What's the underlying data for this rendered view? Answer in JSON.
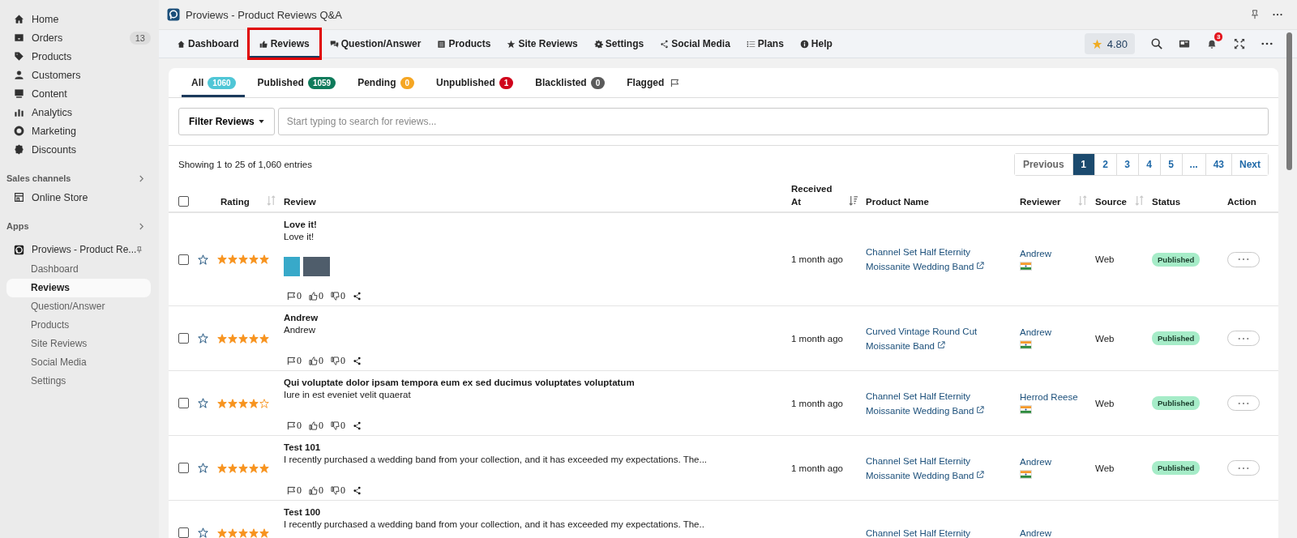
{
  "sidebar": {
    "items": [
      {
        "label": "Home",
        "selected": false
      },
      {
        "label": "Orders",
        "badge": "13",
        "selected": false
      },
      {
        "label": "Products",
        "selected": false
      },
      {
        "label": "Customers",
        "selected": false
      },
      {
        "label": "Content",
        "selected": false
      },
      {
        "label": "Analytics",
        "selected": false
      },
      {
        "label": "Marketing",
        "selected": false
      },
      {
        "label": "Discounts",
        "selected": false
      }
    ],
    "sections": [
      {
        "title": "Sales channels",
        "items": [
          {
            "label": "Online Store"
          }
        ]
      },
      {
        "title": "Apps"
      }
    ],
    "app": {
      "label": "Proviews - Product Re...",
      "children": [
        {
          "label": "Dashboard",
          "selected": false
        },
        {
          "label": "Reviews",
          "selected": true
        },
        {
          "label": "Question/Answer",
          "selected": false
        },
        {
          "label": "Products",
          "selected": false
        },
        {
          "label": "Site Reviews",
          "selected": false
        },
        {
          "label": "Social Media",
          "selected": false
        },
        {
          "label": "Settings",
          "selected": false
        }
      ]
    }
  },
  "window": {
    "title": "Proviews - Product Reviews Q&A"
  },
  "nav": [
    {
      "label": "Dashboard",
      "selected": false,
      "highlighted": false
    },
    {
      "label": "Reviews",
      "selected": true,
      "highlighted": true
    },
    {
      "label": "Question/Answer",
      "selected": false,
      "highlighted": false
    },
    {
      "label": "Products",
      "selected": false,
      "highlighted": false
    },
    {
      "label": "Site Reviews",
      "selected": false,
      "highlighted": false
    },
    {
      "label": "Settings",
      "selected": false,
      "highlighted": false
    },
    {
      "label": "Social Media",
      "selected": false,
      "highlighted": false
    },
    {
      "label": "Plans",
      "selected": false,
      "highlighted": false
    },
    {
      "label": "Help",
      "selected": false,
      "highlighted": false
    }
  ],
  "rating": "4.80",
  "notifications": "3",
  "tabs": [
    {
      "label": "All",
      "count": "1060",
      "color": "#4fc6d6",
      "selected": true
    },
    {
      "label": "Published",
      "count": "1059",
      "color": "#0f7b5b",
      "selected": false
    },
    {
      "label": "Pending",
      "count": "0",
      "color": "#f5a623",
      "selected": false
    },
    {
      "label": "Unpublished",
      "count": "1",
      "color": "#d0021b",
      "selected": false
    },
    {
      "label": "Blacklisted",
      "count": "0",
      "color": "#5a5a5a",
      "selected": false
    },
    {
      "label": "Flagged",
      "selected": false
    }
  ],
  "filter": {
    "label": "Filter Reviews"
  },
  "search": {
    "placeholder": "Start typing to search for reviews..."
  },
  "summary": "Showing 1 to 25 of 1,060 entries",
  "pagination": [
    {
      "label": "Previous",
      "selected": false
    },
    {
      "label": "1",
      "selected": true
    },
    {
      "label": "2",
      "selected": false
    },
    {
      "label": "3",
      "selected": false
    },
    {
      "label": "4",
      "selected": false
    },
    {
      "label": "5",
      "selected": false
    },
    {
      "label": "...",
      "selected": false
    },
    {
      "label": "43",
      "selected": false
    },
    {
      "label": "Next",
      "selected": false
    }
  ],
  "table": {
    "select_all": {
      "checked": false
    },
    "columns": [
      {
        "label": "Rating",
        "sorted": false
      },
      {
        "label": "Review"
      },
      {
        "label": "Received At",
        "sorted": true
      },
      {
        "label": "Product Name"
      },
      {
        "label": "Reviewer",
        "sorted": false
      },
      {
        "label": "Source",
        "sorted": false
      },
      {
        "label": "Status"
      },
      {
        "label": "Action"
      }
    ],
    "rows": [
      {
        "kind": "photos",
        "checked": false,
        "featured": false,
        "stars": 5,
        "title": "Love it!",
        "text": "Love it!",
        "flags": "0",
        "likes": "0",
        "dislikes": "0",
        "received": "1 month ago",
        "product": [
          "Channel Set Half Eternity",
          "Moissanite Wedding Band"
        ],
        "reviewer": "Andrew",
        "source": "Web",
        "status": "Published"
      },
      {
        "kind": "text",
        "checked": false,
        "featured": false,
        "stars": 5,
        "title": "Andrew",
        "text": "Andrew",
        "flags": "0",
        "likes": "0",
        "dislikes": "0",
        "received": "1 month ago",
        "product": [
          "Curved Vintage Round Cut",
          "Moissanite Band"
        ],
        "reviewer": "Andrew",
        "source": "Web",
        "status": "Published"
      },
      {
        "kind": "text",
        "checked": false,
        "featured": false,
        "stars": 4,
        "title": "Qui voluptate dolor ipsam tempora eum ex sed ducimus voluptates voluptatum",
        "text": "Iure in est eveniet velit quaerat",
        "flags": "0",
        "likes": "0",
        "dislikes": "0",
        "received": "1 month ago",
        "product": [
          "Channel Set Half Eternity",
          "Moissanite Wedding Band"
        ],
        "reviewer": "Herrod Reese",
        "source": "Web",
        "status": "Published"
      },
      {
        "kind": "text",
        "checked": false,
        "featured": false,
        "stars": 5,
        "title": "Test 101",
        "text": "I recently purchased a wedding band from your collection, and it has exceeded my expectations. The...",
        "flags": "0",
        "likes": "0",
        "dislikes": "0",
        "received": "1 month ago",
        "product": [
          "Channel Set Half Eternity",
          "Moissanite Wedding Band"
        ],
        "reviewer": "Andrew",
        "source": "Web",
        "status": "Published"
      },
      {
        "kind": "text",
        "checked": false,
        "featured": false,
        "stars": 5,
        "title": "Test 100",
        "text": "I recently purchased a wedding band from your collection, and it has exceeded my expectations. The..",
        "product": [
          "Channel Set Half Eternity"
        ],
        "reviewer": "Andrew"
      }
    ]
  }
}
